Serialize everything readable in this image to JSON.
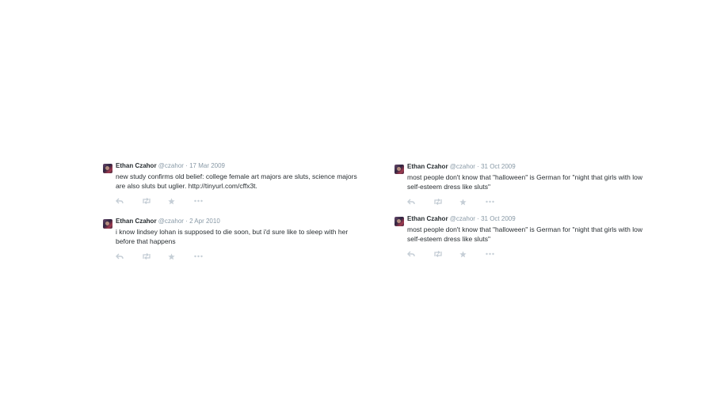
{
  "tweets": [
    {
      "name": "Ethan Czahor",
      "handle": "@czahor",
      "separator": "·",
      "date": "17 Mar 2009",
      "text": "new study confirms old belief: college female art majors are sluts, science majors are also sluts but uglier. http://tinyurl.com/cffx3t.",
      "icons": [
        "reply-icon",
        "retweet-icon",
        "favorite-icon",
        "more-icon"
      ]
    },
    {
      "name": "Ethan Czahor",
      "handle": "@czahor",
      "separator": "·",
      "date": "2 Apr 2010",
      "text": "i know lindsey lohan is supposed to die soon, but i'd sure like to sleep with her before that happens",
      "icons": [
        "reply-icon",
        "retweet-icon",
        "favorite-icon",
        "more-icon"
      ]
    },
    {
      "name": "Ethan Czahor",
      "handle": "@czahor",
      "separator": "·",
      "date": "31 Oct 2009",
      "text": "most people don't know that \"halloween\" is German for \"night that girls with low self-esteem dress like sluts\"",
      "icons": [
        "reply-icon",
        "retweet-icon",
        "favorite-icon",
        "more-icon"
      ]
    },
    {
      "name": "Ethan Czahor",
      "handle": "@czahor",
      "separator": "·",
      "date": "31 Oct 2009",
      "text": "most people don't know that \"halloween\" is German for \"night that girls with low self-esteem dress like sluts\"",
      "icons": [
        "reply-icon",
        "retweet-icon",
        "favorite-icon",
        "more-icon"
      ]
    }
  ],
  "colors": {
    "name": "#292f33",
    "meta": "#8899a6",
    "action_icon": "#c5ced6"
  }
}
